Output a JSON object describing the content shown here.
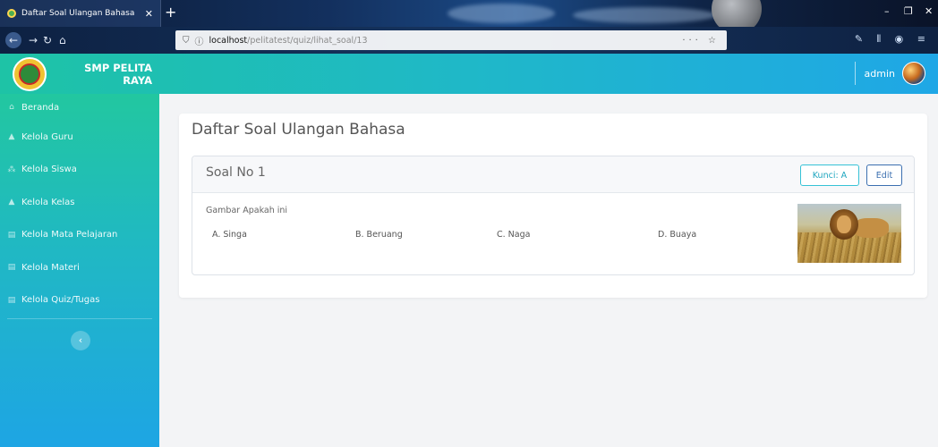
{
  "browser": {
    "tab_title": "Daftar Soal Ulangan Bahasa",
    "tab_close": "✕",
    "new_tab": "+",
    "url_host": "localhost",
    "url_path": "/pelitatest/quiz/lihat_soal/13",
    "window_controls": {
      "minimize": "–",
      "restore": "❐",
      "close": "✕"
    }
  },
  "header": {
    "brand_name": "SMP PELITA RAYA",
    "username": "admin"
  },
  "sidebar": {
    "items": [
      {
        "label": "Beranda",
        "icon": "home-icon"
      },
      {
        "label": "Kelola Guru",
        "icon": "user-icon"
      },
      {
        "label": "Kelola Siswa",
        "icon": "users-icon"
      },
      {
        "label": "Kelola Kelas",
        "icon": "user-icon"
      },
      {
        "label": "Kelola Mata Pelajaran",
        "icon": "list-icon"
      },
      {
        "label": "Kelola Materi",
        "icon": "list-icon"
      },
      {
        "label": "Kelola Quiz/Tugas",
        "icon": "list-icon"
      }
    ],
    "collapse": "‹"
  },
  "main": {
    "panel_title": "Daftar Soal Ulangan Bahasa",
    "question": {
      "title": "Soal No 1",
      "key_button": "Kunci: A",
      "edit_button": "Edit",
      "text": "Gambar Apakah ini",
      "options": [
        {
          "label": "A. Singa"
        },
        {
          "label": "B. Beruang"
        },
        {
          "label": "C. Naga"
        },
        {
          "label": "D. Buaya"
        }
      ]
    }
  }
}
